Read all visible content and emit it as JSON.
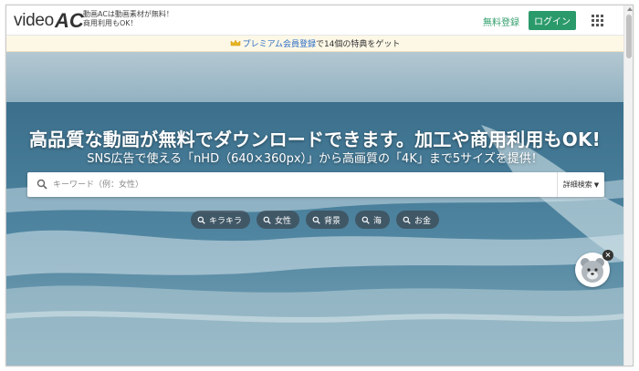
{
  "header": {
    "logo_video": "video",
    "logo_ac": "AC",
    "tagline_1": "動画ACは動画素材が無料！",
    "tagline_2": "商用利用もOK！",
    "register_label": "無料登録",
    "login_label": "ログイン"
  },
  "premium": {
    "link_text": "プレミアム会員登録",
    "rest_text": "で14個の特典をゲット"
  },
  "hero": {
    "title": "高品質な動画が無料でダウンロードできます。加工や商用利用もOK!",
    "subtitle": "SNS広告で使える「nHD（640×360px）」から高画質の「4K」まで5サイズを提供！"
  },
  "search": {
    "placeholder": "キーワード（例：女性）",
    "advanced_label": "詳細検索",
    "advanced_caret": "▼"
  },
  "tags": [
    "キラキラ",
    "女性",
    "背景",
    "海",
    "お金"
  ],
  "mascot": {
    "close_label": "×"
  },
  "colors": {
    "brand_green": "#2b9a6b",
    "link_blue": "#2a6cc5",
    "premium_bg": "#fdf8e6"
  }
}
